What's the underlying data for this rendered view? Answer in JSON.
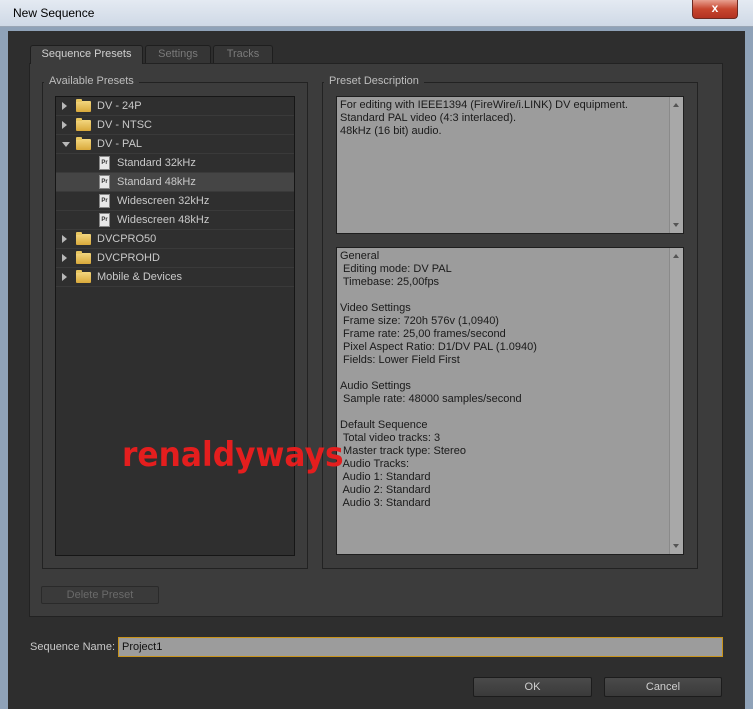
{
  "window": {
    "title": "New Sequence",
    "close_glyph": "x"
  },
  "tabs": [
    {
      "label": "Sequence Presets",
      "active": true
    },
    {
      "label": "Settings",
      "active": false
    },
    {
      "label": "Tracks",
      "active": false
    }
  ],
  "available_presets": {
    "label": "Available Presets",
    "items": [
      {
        "label": "DV - 24P",
        "type": "folder",
        "expanded": false
      },
      {
        "label": "DV - NTSC",
        "type": "folder",
        "expanded": false
      },
      {
        "label": "DV - PAL",
        "type": "folder",
        "expanded": true
      },
      {
        "label": "Standard 32kHz",
        "type": "preset",
        "selected": false
      },
      {
        "label": "Standard 48kHz",
        "type": "preset",
        "selected": true
      },
      {
        "label": "Widescreen 32kHz",
        "type": "preset",
        "selected": false
      },
      {
        "label": "Widescreen 48kHz",
        "type": "preset",
        "selected": false
      },
      {
        "label": "DVCPRO50",
        "type": "folder",
        "expanded": false
      },
      {
        "label": "DVCPROHD",
        "type": "folder",
        "expanded": false
      },
      {
        "label": "Mobile & Devices",
        "type": "folder",
        "expanded": false
      }
    ],
    "preset_icon_text": "Pr"
  },
  "preset_description": {
    "label": "Preset Description",
    "summary": "For editing with IEEE1394 (FireWire/i.LINK) DV equipment.\nStandard PAL video (4:3 interlaced).\n48kHz (16 bit) audio.",
    "details": "General\n Editing mode: DV PAL\n Timebase: 25,00fps\n\nVideo Settings\n Frame size: 720h 576v (1,0940)\n Frame rate: 25,00 frames/second\n Pixel Aspect Ratio: D1/DV PAL (1.0940)\n Fields: Lower Field First\n\nAudio Settings\n Sample rate: 48000 samples/second\n\nDefault Sequence\n Total video tracks: 3\n Master track type: Stereo\n Audio Tracks:\n Audio 1: Standard\n Audio 2: Standard\n Audio 3: Standard"
  },
  "buttons": {
    "delete_preset": "Delete Preset",
    "ok": "OK",
    "cancel": "Cancel"
  },
  "sequence_name": {
    "label": "Sequence Name:",
    "value": "Project1"
  },
  "watermark": "renaldyways",
  "colors": {
    "accent_border": "#c8931b",
    "watermark": "#e41e1e",
    "folder": "#e8c660"
  }
}
